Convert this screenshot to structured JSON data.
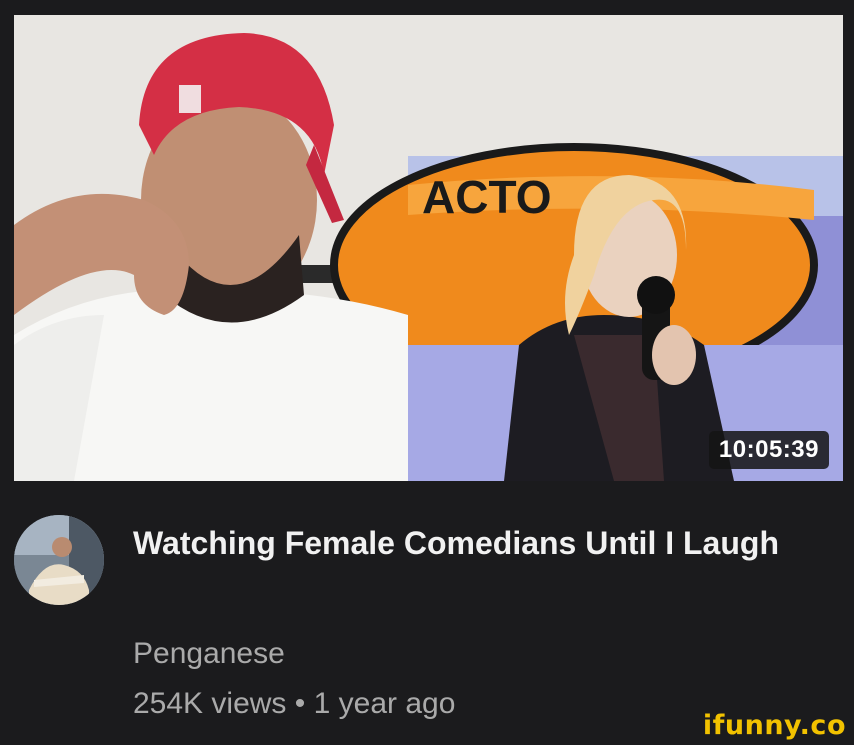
{
  "video": {
    "thumbnail_icon": "video-thumbnail",
    "duration": "10:05:39",
    "thumbnail_sign_text": "ACTO",
    "title": "Watching Female Comedians Until I Laugh",
    "channel": "Penganese",
    "views": "254K views",
    "separator": "•",
    "age": "1 year ago"
  },
  "watermark": {
    "text": "ifunny.co"
  },
  "colors": {
    "background": "#1b1b1d",
    "title": "#f1f1f1",
    "secondary_text": "#aaaaaa",
    "watermark": "#f2c200"
  }
}
